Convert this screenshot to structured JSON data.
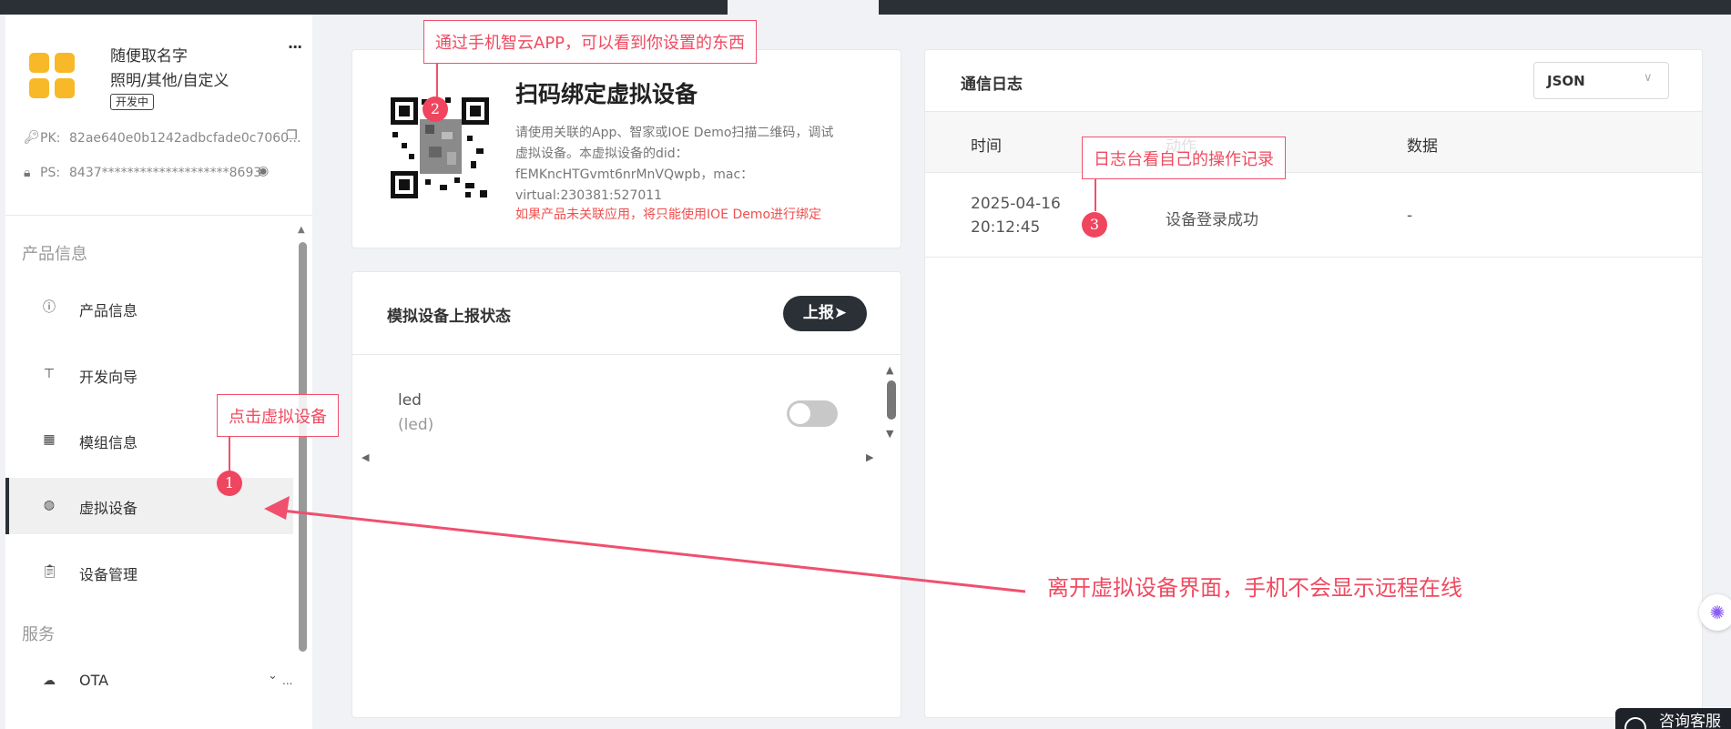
{
  "product": {
    "name": "随便取名字",
    "category": "照明/其他/自定义",
    "badge": "开发中",
    "more": "···",
    "pk_label": "PK:",
    "pk_value": "82ae640e0b1242adbcfade0c7060...",
    "ps_label": "PS:",
    "ps_value": "8437********************8693"
  },
  "sidebar": {
    "groups": [
      "产品信息",
      "服务"
    ],
    "items": [
      {
        "label": "产品信息",
        "icon": "info-circle-icon"
      },
      {
        "label": "开发向导",
        "icon": "signpost-icon"
      },
      {
        "label": "模组信息",
        "icon": "grid-icon"
      },
      {
        "label": "虚拟设备",
        "icon": "globe-icon",
        "active": true
      },
      {
        "label": "设备管理",
        "icon": "clipboard-icon"
      },
      {
        "label": "OTA",
        "icon": "cloud-upload-icon"
      }
    ],
    "ota_more": "..."
  },
  "qr_card": {
    "title": "扫码绑定虚拟设备",
    "description": "请使用关联的App、智家或IOE Demo扫描二维码，调试虚拟设备。本虚拟设备的did：fEMKncHTGvmt6nrMnVQwpb，mac：virtual:230381:527011",
    "warning": "如果产品未关联应用，将只能使用IOE Demo进行绑定"
  },
  "report_card": {
    "title": "模拟设备上报状态",
    "button": "上报➤",
    "fields": [
      {
        "name": "led",
        "sub": "(led)",
        "toggle_on": false
      }
    ]
  },
  "log_card": {
    "title": "通信日志",
    "format": "JSON",
    "columns": [
      "时间",
      "动作",
      "数据"
    ],
    "rows": [
      {
        "date": "2025-04-16",
        "time": "20:12:45",
        "action": "设备登录成功",
        "data": "-"
      }
    ]
  },
  "annotations": {
    "note1": "点击虚拟设备",
    "note2": "通过手机智云APP，可以看到你设置的东西",
    "note3": "日志台看自己的操作记录",
    "n1": "1",
    "n2": "2",
    "n3": "3",
    "big": "离开虚拟设备界面，手机不会显示远程在线"
  },
  "consult": "咨询客服",
  "colors": {
    "accent": "#f0455f",
    "dark": "#2b2f36",
    "brand_yellow": "#f7b928"
  }
}
